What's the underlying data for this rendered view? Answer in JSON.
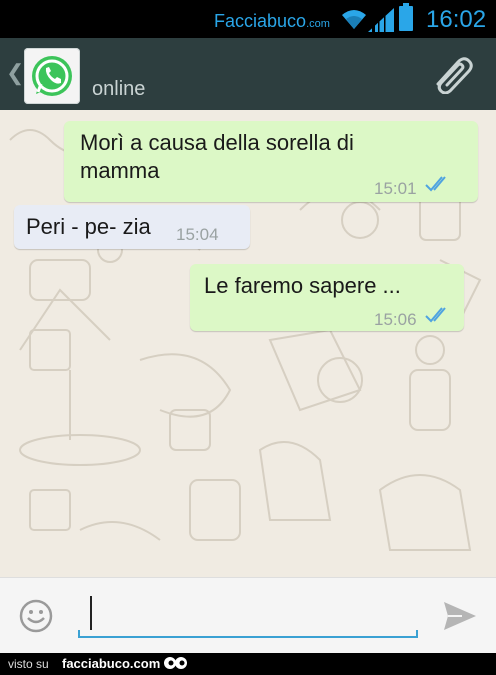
{
  "statusbar": {
    "brand_main": "Facciabuco",
    "brand_suffix": ".com",
    "time": "16:02",
    "icons": [
      "wifi-icon",
      "signal-icon",
      "battery-icon"
    ]
  },
  "header": {
    "status": "online",
    "avatar_icon": "whatsapp-logo-icon",
    "attach_icon": "paperclip-icon",
    "back_icon": "chevron-left-icon"
  },
  "messages": [
    {
      "direction": "out",
      "lines": [
        "Morì a causa della sorella di",
        "mamma"
      ],
      "time": "15:01",
      "ticks": "double-check"
    },
    {
      "direction": "in",
      "lines": [
        "Peri - pe- zia"
      ],
      "time": "15:04"
    },
    {
      "direction": "out",
      "lines": [
        "Le faremo sapere ..."
      ],
      "time": "15:06",
      "ticks": "double-check"
    }
  ],
  "input": {
    "value": "",
    "emoji_icon": "smiley-icon",
    "send_icon": "send-icon"
  },
  "footer": {
    "prefix": "visto su",
    "site": "facciabuco.com"
  },
  "colors": {
    "header_bg": "#2d3e3f",
    "chat_bg": "#f0ebe2",
    "outgoing_bubble": "#dcf8c6",
    "incoming_bubble": "#e8ecf5",
    "accent": "#2aa6e8"
  }
}
